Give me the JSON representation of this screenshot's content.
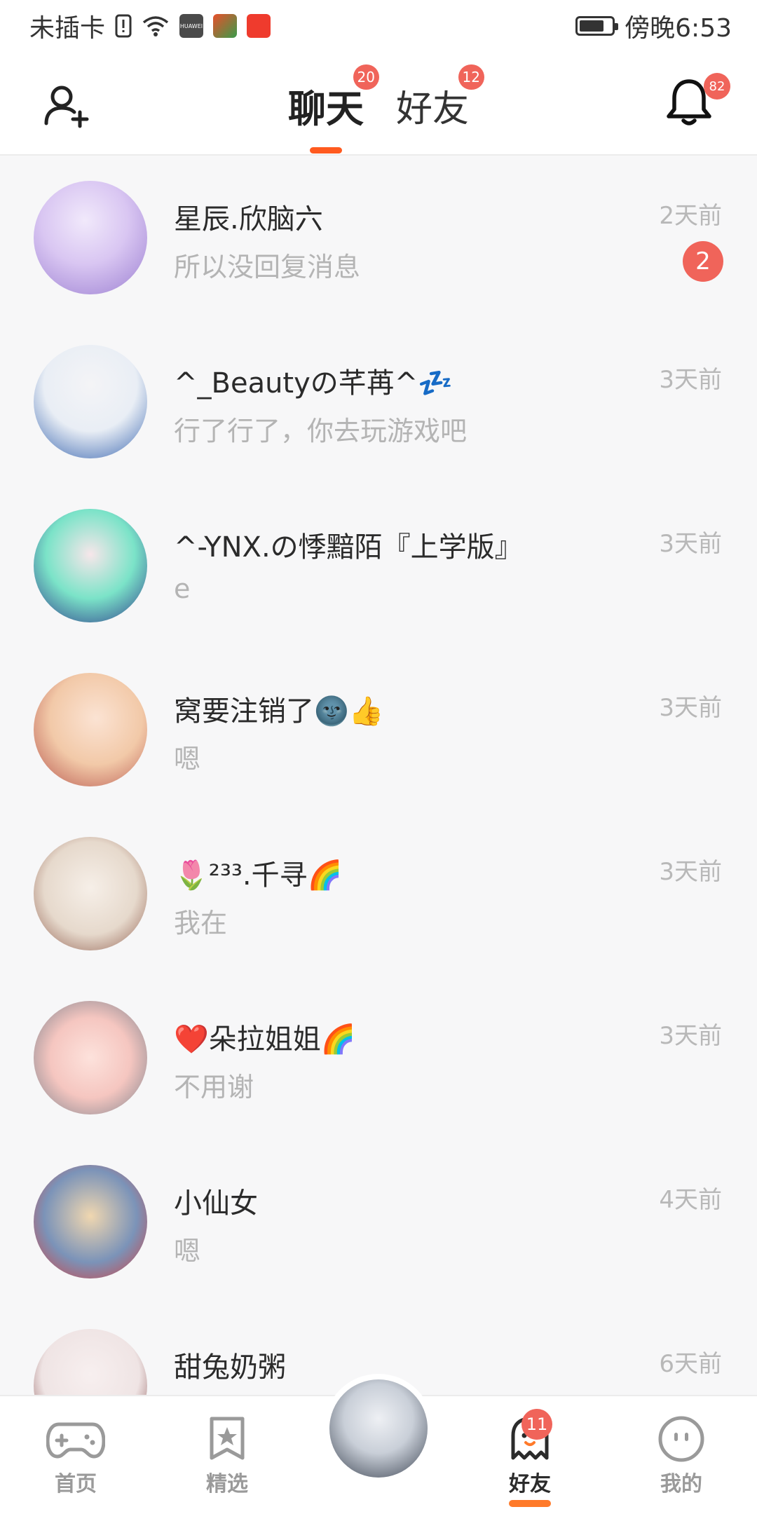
{
  "status_bar": {
    "carrier": "未插卡",
    "time": "傍晚6:53",
    "icons": [
      "sim-warning-icon",
      "wifi-icon",
      "huawei-app-icon",
      "game-app-icon",
      "store-app-icon",
      "battery-icon"
    ],
    "huawei_label": "HUAWEI"
  },
  "header": {
    "tabs": [
      {
        "label": "聊天",
        "badge": "20",
        "active": true
      },
      {
        "label": "好友",
        "badge": "12",
        "active": false
      }
    ],
    "bell_badge": "82",
    "accent": "#ff5a1f"
  },
  "chats": [
    {
      "name": "星辰.欣脑六",
      "preview": "所以没回复消息",
      "time": "2天前",
      "unread": "2",
      "avatar_colors": [
        "#d9c6f2",
        "#9b7fd1"
      ]
    },
    {
      "name": "^_Beautyの芊苒^💤",
      "preview": "行了行了，你去玩游戏吧",
      "time": "3天前",
      "unread": "",
      "avatar_colors": [
        "#e9eef5",
        "#3a66b0"
      ]
    },
    {
      "name": "^-YNX.の悸黯陌『上学版』",
      "preview": "e",
      "time": "3天前",
      "unread": "",
      "avatar_colors": [
        "#7be3c8",
        "#2c3a8a"
      ]
    },
    {
      "name": "窝要注销了🌚👍",
      "preview": "嗯",
      "time": "3天前",
      "unread": "",
      "avatar_colors": [
        "#f2c9a8",
        "#b5524a"
      ]
    },
    {
      "name": "🌷²³³.千寻🌈",
      "preview": "我在",
      "time": "3天前",
      "unread": "",
      "avatar_colors": [
        "#e6d9cc",
        "#8e5a4a"
      ]
    },
    {
      "name": "❤️朵拉姐姐🌈",
      "preview": "不用谢",
      "time": "3天前",
      "unread": "",
      "avatar_colors": [
        "#f5c6c0",
        "#7a7f8a"
      ]
    },
    {
      "name": "小仙女",
      "preview": "嗯",
      "time": "4天前",
      "unread": "",
      "avatar_colors": [
        "#7b93b8",
        "#d63a3a"
      ]
    },
    {
      "name": "甜兔奶粥",
      "preview": "",
      "time": "6天前",
      "unread": "",
      "avatar_colors": [
        "#efe4e4",
        "#6b2a2a"
      ]
    }
  ],
  "bottom_nav": {
    "items": [
      {
        "label": "首页",
        "icon": "gamepad-icon",
        "active": false
      },
      {
        "label": "精选",
        "icon": "star-bookmark-icon",
        "active": false
      },
      {
        "label": "好友",
        "icon": "ghost-icon",
        "active": true,
        "badge": "11"
      },
      {
        "label": "我的",
        "icon": "face-icon",
        "active": false
      }
    ],
    "center_avatar_colors": [
      "#c9cfd8",
      "#3a4250"
    ]
  }
}
